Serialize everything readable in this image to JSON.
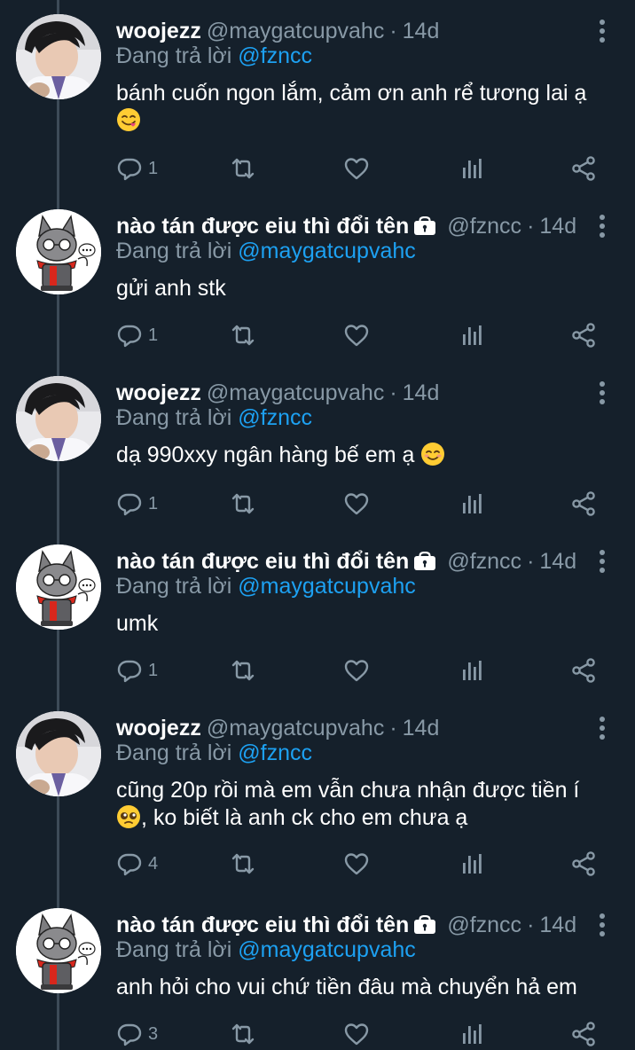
{
  "colors": {
    "background": "#15202b",
    "secondary_text": "#8899a6",
    "mention": "#1da1f2",
    "thread_line": "#3d4b58"
  },
  "icons": {
    "reply": "speech-bubble-icon",
    "retweet": "retweet-icon",
    "like": "heart-icon",
    "stats": "bar-chart-icon",
    "share": "share-icon",
    "more": "vertical-ellipsis-icon",
    "lock": "lock-icon"
  },
  "tweets": [
    {
      "name": "woojezz",
      "handle": "@maygatcupvahc",
      "time": "14d",
      "reply_prefix": "Đang trả lời",
      "reply_to": "@fzncc",
      "text": "bánh cuốn ngon lắm, cảm ơn anh rể tương lai ạ",
      "emoji": "face-savoring-food",
      "reply_count": "1"
    },
    {
      "name": "nào tán được eiu thì đổi tên",
      "handle": "@fzncc",
      "time": "14d",
      "reply_prefix": "Đang trả lời",
      "reply_to": "@maygatcupvahc",
      "text": "gửi anh stk",
      "reply_count": "1"
    },
    {
      "name": "woojezz",
      "handle": "@maygatcupvahc",
      "time": "14d",
      "reply_prefix": "Đang trả lời",
      "reply_to": "@fzncc",
      "text": "dạ 990xxy ngân hàng bế em ạ",
      "emoji": "smiling-face-with-smiling-eyes",
      "reply_count": "1"
    },
    {
      "name": "nào tán được eiu thì đổi tên",
      "handle": "@fzncc",
      "time": "14d",
      "reply_prefix": "Đang trả lời",
      "reply_to": "@maygatcupvahc",
      "text": "umk",
      "reply_count": "1"
    },
    {
      "name": "woojezz",
      "handle": "@maygatcupvahc",
      "time": "14d",
      "reply_prefix": "Đang trả lời",
      "reply_to": "@fzncc",
      "text": "cũng 20p rồi mà em vẫn chưa nhận được tiền í",
      "emoji": "pleading-face",
      "text_after": ", ko biết là anh ck cho em chưa ạ",
      "reply_count": "4"
    },
    {
      "name": "nào tán được eiu thì đổi tên",
      "handle": "@fzncc",
      "time": "14d",
      "reply_prefix": "Đang trả lời",
      "reply_to": "@maygatcupvahc",
      "text": "anh hỏi cho vui chứ tiền đâu mà chuyển hả em",
      "reply_count": "3"
    }
  ]
}
